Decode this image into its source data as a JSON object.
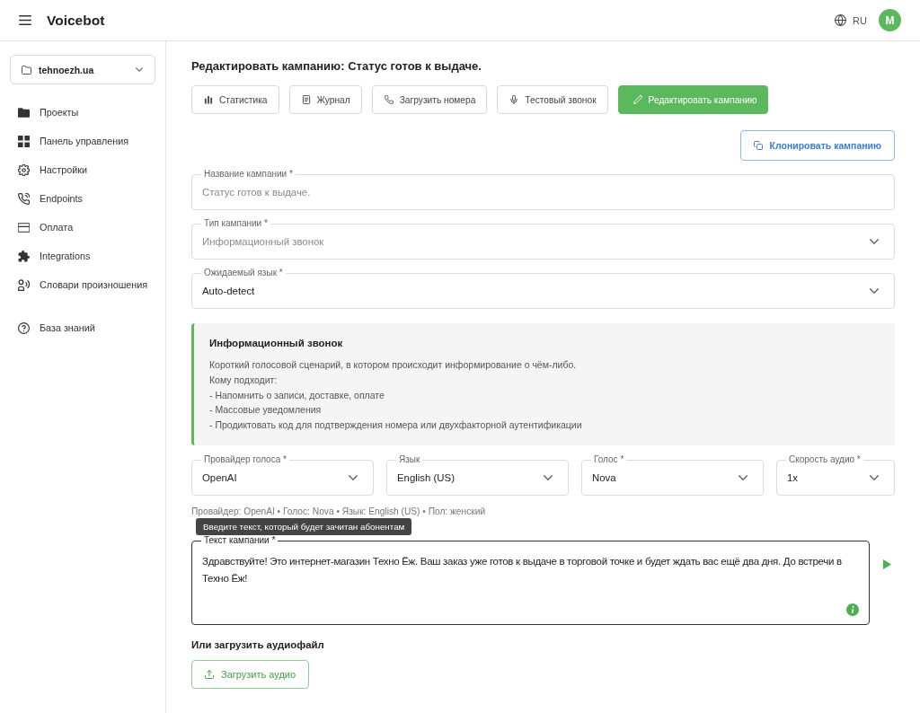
{
  "header": {
    "title": "Voicebot",
    "language": "RU",
    "avatar": "M"
  },
  "sidebar": {
    "project": "tehnoezh.ua",
    "groups": [
      {
        "items": [
          {
            "label": "Проекты"
          },
          {
            "label": "Панель управления"
          },
          {
            "label": "Настройки"
          },
          {
            "label": "Endpoints"
          },
          {
            "label": "Оплата"
          },
          {
            "label": "Integrations"
          },
          {
            "label": "Словари произношения"
          }
        ]
      },
      {
        "items": [
          {
            "label": "База знаний"
          }
        ]
      }
    ]
  },
  "page_title": "Редактировать кампанию: Статус готов к выдаче.",
  "toolbar": {
    "tabs": [
      {
        "label": "Статистика",
        "selected": false
      },
      {
        "label": "Журнал",
        "selected": false
      },
      {
        "label": "Загрузить номера",
        "selected": false
      },
      {
        "label": "Тестовый звонок",
        "selected": false
      },
      {
        "label": "Редактировать кампанию",
        "selected": true
      }
    ]
  },
  "clone_button": "Клонировать кампанию",
  "fields": [
    {
      "kind": "input",
      "label": "Название кампании *",
      "value": "Статус готов к выдаче.",
      "disabled": true
    },
    {
      "kind": "select",
      "label": "Тип кампании *",
      "value": "Информационный звонок",
      "disabled": true
    },
    {
      "kind": "select",
      "label": "Ожидаемый язык *",
      "value": "Auto-detect",
      "disabled": false
    }
  ],
  "info_panel": {
    "title": "Информационный звонок",
    "lines": [
      "Короткий голосовой сценарий, в котором происходит информирование о чём-либо.",
      "Кому подходит:",
      "- Напомнить о записи, доставке, оплате",
      "- Массовые уведомления",
      "- Продиктовать код для подтверждения номера или двухфакторной аутентификации"
    ]
  },
  "voice_settings": [
    {
      "label": "Провайдер голоса *",
      "value": "OpenAI"
    },
    {
      "label": "Язык",
      "value": "English (US)"
    },
    {
      "label": "Голос *",
      "value": "Nova"
    },
    {
      "label": "Скорость аудио *",
      "value": "1x"
    }
  ],
  "voice_summary": "Провайдер: OpenAI • Голос: Nova • Язык: English (US) • Пол: женский",
  "campaign_text": {
    "label": "Текст кампании *",
    "value": "Здравствуйте! Это интернет-магазин Техно Ёж. Ваш заказ уже готов к выдаче в торговой точке и будет ждать вас ещё два дня. До встречи в Техно Ёж!",
    "tooltip": "Введите текст, который будет зачитан абонентам",
    "focused": true
  },
  "audio_upload": {
    "heading": "Или загрузить аудиофайл",
    "button": "Загрузить аудио"
  }
}
